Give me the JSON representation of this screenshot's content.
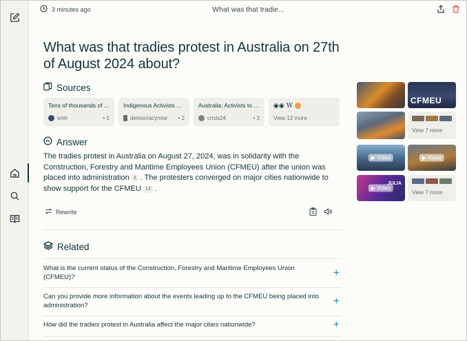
{
  "topbar": {
    "time_ago": "3 minutes ago",
    "title": "What was that tradie..."
  },
  "question": "What was that tradies protest in Australia on 27th of August 2024 about?",
  "sources": {
    "heading": "Sources",
    "items": [
      {
        "title": "Tens of thousands of ...",
        "site": "smh",
        "count": "• 1",
        "favicon_color": "#3b4a6b"
      },
      {
        "title": "Indigenous Activists ...",
        "site": "democracynow",
        "count": "• 2",
        "favicon_color": "#6b6b6b"
      },
      {
        "title": "Australia: Activists to ...",
        "site": "crisis24",
        "count": "• 3",
        "favicon_color": "#7a8488"
      }
    ],
    "view_more": "View 12 more"
  },
  "answer": {
    "heading": "Answer",
    "text_part1": "The tradies protest in Australia on August 27, 2024, was in solidarity with the Construction, Forestry and Maritime Employees Union (CFMEU) after the union was placed into administration",
    "cite1": "3",
    "text_part2": ". The protesters converged on major cities nationwide to show support for the CFMEU",
    "cite2": "13",
    "text_part3": ".",
    "rewrite_label": "Rewrite"
  },
  "related": {
    "heading": "Related",
    "items": [
      "What is the current status of the Construction, Forestry and Maritime Employees Union (CFMEU)?",
      "Can you provide more information about the events leading up to the CFMEU being placed into administration?",
      "How did the tradies protest in Australia affect the major cities nationwide?"
    ]
  },
  "media": {
    "thumb_text_cfmeu": "CFMEU",
    "view_more_images": "View 7 more",
    "video_label": "Video",
    "view_more_videos": "View 7 more",
    "video_caption": "JULIA"
  },
  "colors": {
    "accent": "#1f8fa6",
    "text": "#13343b",
    "background": "#fcfcf9",
    "card": "#efefe9",
    "delete": "#d9534f"
  }
}
